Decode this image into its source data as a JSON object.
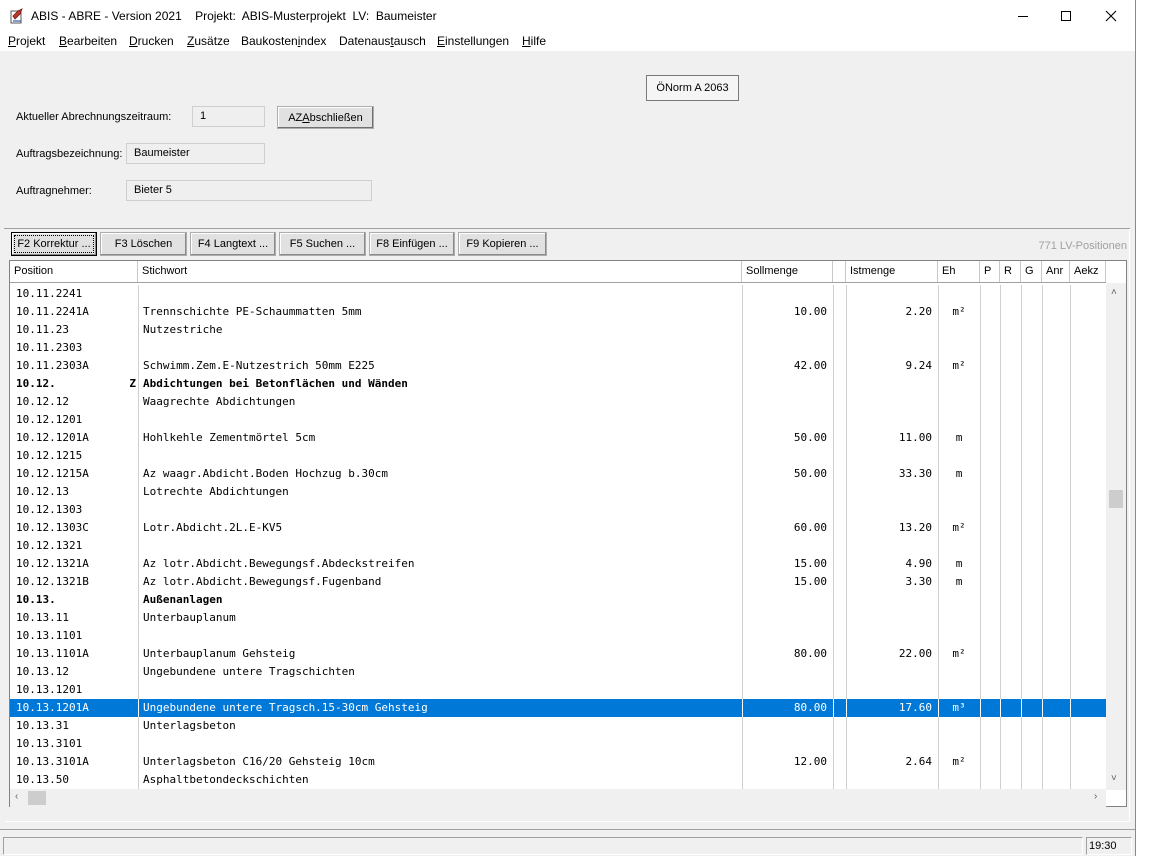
{
  "window": {
    "app_title": "ABIS - ABRE - Version 2021",
    "project_label": "Projekt:",
    "project_name": "ABIS-Musterprojekt",
    "lv_label": "LV:",
    "lv_name": "Baumeister"
  },
  "menu": [
    {
      "label": "Projekt",
      "accel": "P",
      "rest": "rojekt"
    },
    {
      "label": "Bearbeiten",
      "accel": "B",
      "rest": "earbeiten"
    },
    {
      "label": "Drucken",
      "accel": "D",
      "rest": "rucken"
    },
    {
      "label": "Zusätze",
      "accel": "Z",
      "rest": "usätze"
    },
    {
      "label": "Baukostenindex",
      "pre": "Baukosten",
      "accel": "i",
      "rest": "ndex"
    },
    {
      "label": "Datenaustausch",
      "pre": "Datenaus",
      "accel": "t",
      "rest": "ausch"
    },
    {
      "label": "Einstellungen",
      "accel": "E",
      "rest": "instellungen"
    },
    {
      "label": "Hilfe",
      "accel": "H",
      "rest": "ilfe"
    }
  ],
  "header": {
    "norm_button": "ÖNorm A 2063",
    "period_label": "Aktueller Abrechnungszeitraum:",
    "period_value": "1",
    "close_period_pre": "AZ ",
    "close_period_accel": "A",
    "close_period_rest": "bschließen",
    "contract_label": "Auftragsbezeichnung:",
    "contract_value": "Baumeister",
    "contractor_label": "Auftragnehmer:",
    "contractor_value": "Bieter 5"
  },
  "toolbar": {
    "buttons": [
      "F2 Korrektur ...",
      "F3 Löschen",
      "F4 Langtext ...",
      "F5 Suchen ...",
      "F8 Einfügen ...",
      "F9 Kopieren ..."
    ],
    "position_count": "771 LV-Positionen"
  },
  "table": {
    "columns": [
      "Position",
      "Stichwort",
      "Sollmenge",
      "",
      "Istmenge",
      "Eh",
      "P",
      "R",
      "G",
      "Anr",
      "Aekz"
    ],
    "rows": [
      {
        "pos": "10.11.2241",
        "flag": "",
        "text": "",
        "soll": "",
        "ist": "",
        "eh": ""
      },
      {
        "pos": "10.11.2241A",
        "flag": "",
        "text": "Trennschichte PE-Schaummatten 5mm",
        "soll": "10.00",
        "ist": "2.20",
        "eh": "m²"
      },
      {
        "pos": "10.11.23",
        "flag": "",
        "text": "Nutzestriche",
        "soll": "",
        "ist": "",
        "eh": ""
      },
      {
        "pos": "10.11.2303",
        "flag": "",
        "text": "",
        "soll": "",
        "ist": "",
        "eh": ""
      },
      {
        "pos": "10.11.2303A",
        "flag": "",
        "text": "Schwimm.Zem.E-Nutzestrich 50mm E225",
        "soll": "42.00",
        "ist": "9.24",
        "eh": "m²"
      },
      {
        "pos": "10.12.",
        "flag": "Z",
        "text": "Abdichtungen bei Betonflächen und Wänden",
        "soll": "",
        "ist": "",
        "eh": "",
        "bold": true
      },
      {
        "pos": "10.12.12",
        "flag": "",
        "text": "Waagrechte Abdichtungen",
        "soll": "",
        "ist": "",
        "eh": ""
      },
      {
        "pos": "10.12.1201",
        "flag": "",
        "text": "",
        "soll": "",
        "ist": "",
        "eh": ""
      },
      {
        "pos": "10.12.1201A",
        "flag": "",
        "text": "Hohlkehle Zementmörtel 5cm",
        "soll": "50.00",
        "ist": "11.00",
        "eh": "m"
      },
      {
        "pos": "10.12.1215",
        "flag": "",
        "text": "",
        "soll": "",
        "ist": "",
        "eh": ""
      },
      {
        "pos": "10.12.1215A",
        "flag": "",
        "text": "Az waagr.Abdicht.Boden Hochzug b.30cm",
        "soll": "50.00",
        "ist": "33.30",
        "eh": "m"
      },
      {
        "pos": "10.12.13",
        "flag": "",
        "text": "Lotrechte Abdichtungen",
        "soll": "",
        "ist": "",
        "eh": ""
      },
      {
        "pos": "10.12.1303",
        "flag": "",
        "text": "",
        "soll": "",
        "ist": "",
        "eh": ""
      },
      {
        "pos": "10.12.1303C",
        "flag": "",
        "text": "Lotr.Abdicht.2L.E-KV5",
        "soll": "60.00",
        "ist": "13.20",
        "eh": "m²"
      },
      {
        "pos": "10.12.1321",
        "flag": "",
        "text": "",
        "soll": "",
        "ist": "",
        "eh": ""
      },
      {
        "pos": "10.12.1321A",
        "flag": "",
        "text": "Az lotr.Abdicht.Bewegungsf.Abdeckstreifen",
        "soll": "15.00",
        "ist": "4.90",
        "eh": "m"
      },
      {
        "pos": "10.12.1321B",
        "flag": "",
        "text": "Az lotr.Abdicht.Bewegungsf.Fugenband",
        "soll": "15.00",
        "ist": "3.30",
        "eh": "m"
      },
      {
        "pos": "10.13.",
        "flag": "",
        "text": "Außenanlagen",
        "soll": "",
        "ist": "",
        "eh": "",
        "bold": true
      },
      {
        "pos": "10.13.11",
        "flag": "",
        "text": "Unterbauplanum",
        "soll": "",
        "ist": "",
        "eh": ""
      },
      {
        "pos": "10.13.1101",
        "flag": "",
        "text": "",
        "soll": "",
        "ist": "",
        "eh": ""
      },
      {
        "pos": "10.13.1101A",
        "flag": "",
        "text": "Unterbauplanum Gehsteig",
        "soll": "80.00",
        "ist": "22.00",
        "eh": "m²"
      },
      {
        "pos": "10.13.12",
        "flag": "",
        "text": "Ungebundene untere Tragschichten",
        "soll": "",
        "ist": "",
        "eh": ""
      },
      {
        "pos": "10.13.1201",
        "flag": "",
        "text": "",
        "soll": "",
        "ist": "",
        "eh": ""
      },
      {
        "pos": "10.13.1201A",
        "flag": "",
        "text": "Ungebundene untere Tragsch.15-30cm Gehsteig",
        "soll": "80.00",
        "ist": "17.60",
        "eh": "m³",
        "selected": true
      },
      {
        "pos": "10.13.31",
        "flag": "",
        "text": "Unterlagsbeton",
        "soll": "",
        "ist": "",
        "eh": ""
      },
      {
        "pos": "10.13.3101",
        "flag": "",
        "text": "",
        "soll": "",
        "ist": "",
        "eh": ""
      },
      {
        "pos": "10.13.3101A",
        "flag": "",
        "text": "Unterlagsbeton C16/20 Gehsteig 10cm",
        "soll": "12.00",
        "ist": "2.64",
        "eh": "m²"
      },
      {
        "pos": "10.13.50",
        "flag": "",
        "text": "Asphaltbetondeckschichten",
        "soll": "",
        "ist": "",
        "eh": ""
      }
    ]
  },
  "status": {
    "time": "19:30"
  },
  "colors": {
    "selection": "#0078d7",
    "window_bg": "#f0f0f0"
  }
}
